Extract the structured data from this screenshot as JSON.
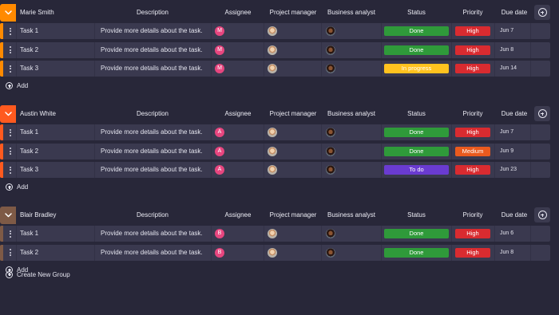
{
  "columns": {
    "description": "Description",
    "assignee": "Assignee",
    "project_manager": "Project manager",
    "business_analyst": "Business analyst",
    "status": "Status",
    "priority": "Priority",
    "due_date": "Due date"
  },
  "add_label": "Add",
  "create_group_label": "Create New Group",
  "colors": {
    "done": "#2f9a3a",
    "in_progress": "#ffc21f",
    "to_do": "#6a3bd1",
    "high": "#d92b30",
    "medium": "#ea5a1e",
    "group_orange": "#ff8a00",
    "group_red": "#ff5a1f",
    "group_brown": "#7e5a46"
  },
  "groups": [
    {
      "name": "Marie Smith",
      "color": "#ff8a00",
      "stripe": "#ff8a00",
      "initial": "M",
      "tasks": [
        {
          "name": "Task 1",
          "description": "Provide more details about the task.",
          "status": "Done",
          "status_color": "#2f9a3a",
          "priority": "High",
          "priority_color": "#d92b30",
          "due": "Jun 7"
        },
        {
          "name": "Task 2",
          "description": "Provide more details about the task.",
          "status": "Done",
          "status_color": "#2f9a3a",
          "priority": "High",
          "priority_color": "#d92b30",
          "due": "Jun 8"
        },
        {
          "name": "Task 3",
          "description": "Provide more details about the task.",
          "status": "In progress",
          "status_color": "#ffc21f",
          "priority": "High",
          "priority_color": "#d92b30",
          "due": "Jun 14"
        }
      ]
    },
    {
      "name": "Austin White",
      "color": "#ff5a1f",
      "stripe": "#ff5a1f",
      "initial": "A",
      "tasks": [
        {
          "name": "Task 1",
          "description": "Provide more details about the task.",
          "status": "Done",
          "status_color": "#2f9a3a",
          "priority": "High",
          "priority_color": "#d92b30",
          "due": "Jun 7"
        },
        {
          "name": "Task 2",
          "description": "Provide more details about the task.",
          "status": "Done",
          "status_color": "#2f9a3a",
          "priority": "Medium",
          "priority_color": "#ea5a1e",
          "due": "Jun 9"
        },
        {
          "name": "Task 3",
          "description": "Provide more details about the task.",
          "status": "To do",
          "status_color": "#6a3bd1",
          "priority": "High",
          "priority_color": "#d92b30",
          "due": "Jun 23"
        }
      ]
    },
    {
      "name": "Blair Bradley",
      "color": "#7e5a46",
      "stripe": "#7e5a46",
      "initial": "B",
      "tasks": [
        {
          "name": "Task 1",
          "description": "Provide more details about the task.",
          "status": "Done",
          "status_color": "#2f9a3a",
          "priority": "High",
          "priority_color": "#d92b30",
          "due": "Jun 6"
        },
        {
          "name": "Task 2",
          "description": "Provide more details about the task.",
          "status": "Done",
          "status_color": "#2f9a3a",
          "priority": "High",
          "priority_color": "#d92b30",
          "due": "Jun 8"
        }
      ]
    }
  ]
}
